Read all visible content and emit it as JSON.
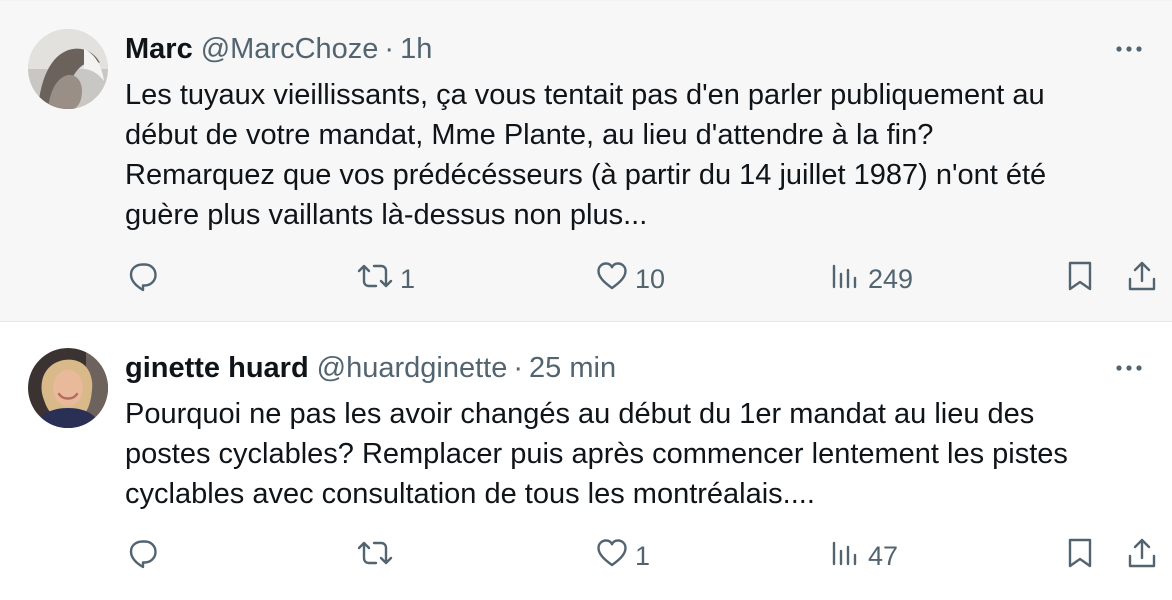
{
  "tweets": [
    {
      "display_name": "Marc",
      "handle": "@MarcChoze",
      "separator": "·",
      "time": "1h",
      "lines": [
        "Les tuyaux vieillissants, ça vous tentait pas d'en parler publiquement au",
        "début de votre mandat, Mme Plante, au lieu d'attendre à la fin?",
        "Remarquez que vos prédécésseurs (à partir du 14 juillet 1987) n'ont été",
        "guère plus vaillants là-dessus non plus..."
      ],
      "reply_count": "",
      "repost_count": "1",
      "like_count": "10",
      "view_count": "249"
    },
    {
      "display_name": "ginette huard",
      "handle": "@huardginette",
      "separator": "·",
      "time": "25 min",
      "lines": [
        "Pourquoi ne pas les avoir changés au début du 1er mandat au lieu des",
        "postes cyclables? Remplacer puis après commencer lentement les pistes",
        "cyclables avec consultation de tous les montréalais...."
      ],
      "reply_count": "",
      "repost_count": "",
      "like_count": "1",
      "view_count": "47"
    }
  ],
  "icons": {
    "reply": "reply-icon",
    "repost": "repost-icon",
    "like": "heart-icon",
    "views": "views-icon",
    "bookmark": "bookmark-icon",
    "share": "share-icon",
    "more": "more-icon"
  },
  "colors": {
    "text": "#0f1419",
    "secondary": "#536471",
    "highlighted_background": "#f7f7f7"
  }
}
